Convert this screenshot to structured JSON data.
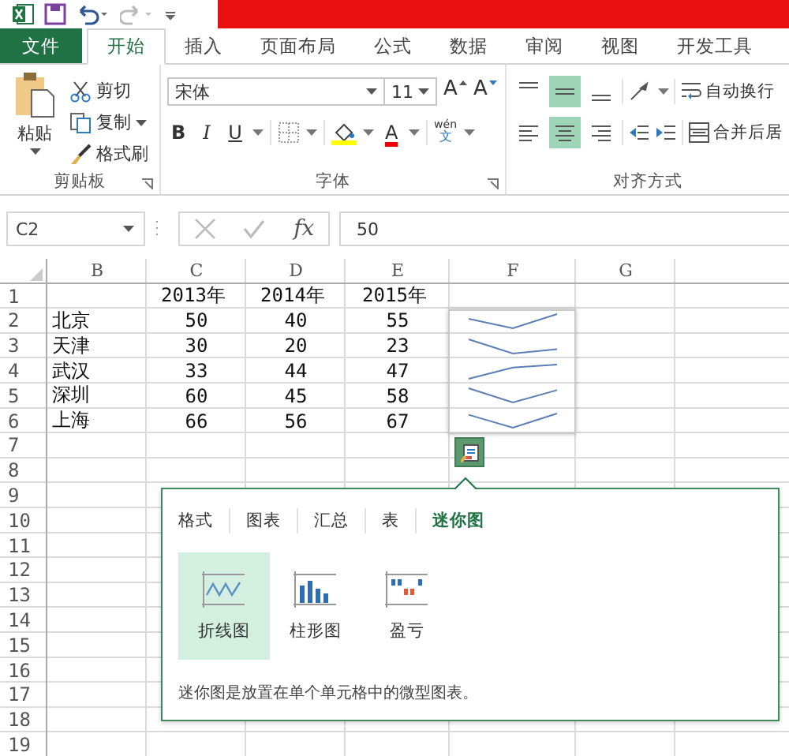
{
  "ribbon_tabs": [
    {
      "label": "文件",
      "kind": "file",
      "selected": false
    },
    {
      "label": "开始",
      "kind": "tab",
      "selected": true
    },
    {
      "label": "插入",
      "kind": "tab",
      "selected": false
    },
    {
      "label": "页面布局",
      "kind": "tab",
      "selected": false
    },
    {
      "label": "公式",
      "kind": "tab",
      "selected": false
    },
    {
      "label": "数据",
      "kind": "tab",
      "selected": false
    },
    {
      "label": "审阅",
      "kind": "tab",
      "selected": false
    },
    {
      "label": "视图",
      "kind": "tab",
      "selected": false
    },
    {
      "label": "开发工具",
      "kind": "tab",
      "selected": false
    }
  ],
  "clipboard": {
    "paste": "粘贴",
    "cut": "剪切",
    "copy": "复制",
    "format_painter": "格式刷",
    "group_label": "剪贴板"
  },
  "font": {
    "name": "宋体",
    "size": "11",
    "grow": "A",
    "shrink": "A",
    "bold": "B",
    "italic": "I",
    "underline": "U",
    "font_color": "A",
    "phonetic_top": "wén",
    "phonetic_bottom": "文",
    "group_label": "字体"
  },
  "alignment": {
    "vertical": [
      {
        "kind": "top",
        "selected": false
      },
      {
        "kind": "middle",
        "selected": true
      },
      {
        "kind": "bottom",
        "selected": false
      }
    ],
    "horizontal": [
      {
        "kind": "left",
        "selected": false
      },
      {
        "kind": "center",
        "selected": true
      },
      {
        "kind": "right",
        "selected": false
      }
    ],
    "wrap_text": "自动换行",
    "merge": "合并后居",
    "group_label": "对齐方式"
  },
  "name_box": "C2",
  "fx": "fx",
  "formula": "50",
  "sheet": {
    "columns": [
      "B",
      "C",
      "D",
      "E",
      "F",
      "G"
    ],
    "rows": [
      {
        "number": "1",
        "headers": [
          "2013年",
          "2014年",
          "2015年"
        ]
      },
      {
        "number": "2",
        "label": "北京",
        "values": [
          "50",
          "40",
          "55"
        ]
      },
      {
        "number": "3",
        "label": "天津",
        "values": [
          "30",
          "20",
          "23"
        ]
      },
      {
        "number": "4",
        "label": "武汉",
        "values": [
          "33",
          "44",
          "47"
        ]
      },
      {
        "number": "5",
        "label": "深圳",
        "values": [
          "60",
          "45",
          "58"
        ]
      },
      {
        "number": "6",
        "label": "上海",
        "values": [
          "66",
          "56",
          "67"
        ]
      },
      {
        "number": "7"
      },
      {
        "number": "8"
      },
      {
        "number": "9"
      },
      {
        "number": "10"
      },
      {
        "number": "11"
      },
      {
        "number": "12"
      },
      {
        "number": "13"
      },
      {
        "number": "14"
      },
      {
        "number": "15"
      },
      {
        "number": "16"
      },
      {
        "number": "17"
      },
      {
        "number": "18"
      },
      {
        "number": "19"
      }
    ]
  },
  "quick_analysis": {
    "tabs": [
      {
        "label": "格式",
        "selected": false
      },
      {
        "label": "图表",
        "selected": false
      },
      {
        "label": "汇总",
        "selected": false
      },
      {
        "label": "表",
        "selected": false
      },
      {
        "label": "迷你图",
        "selected": true
      }
    ],
    "options": [
      {
        "label": "折线图",
        "kind": "line",
        "selected": true
      },
      {
        "label": "柱形图",
        "kind": "column",
        "selected": false
      },
      {
        "label": "盈亏",
        "kind": "winloss",
        "selected": false
      }
    ],
    "description": "迷你图是放置在单个单元格中的微型图表。"
  }
}
